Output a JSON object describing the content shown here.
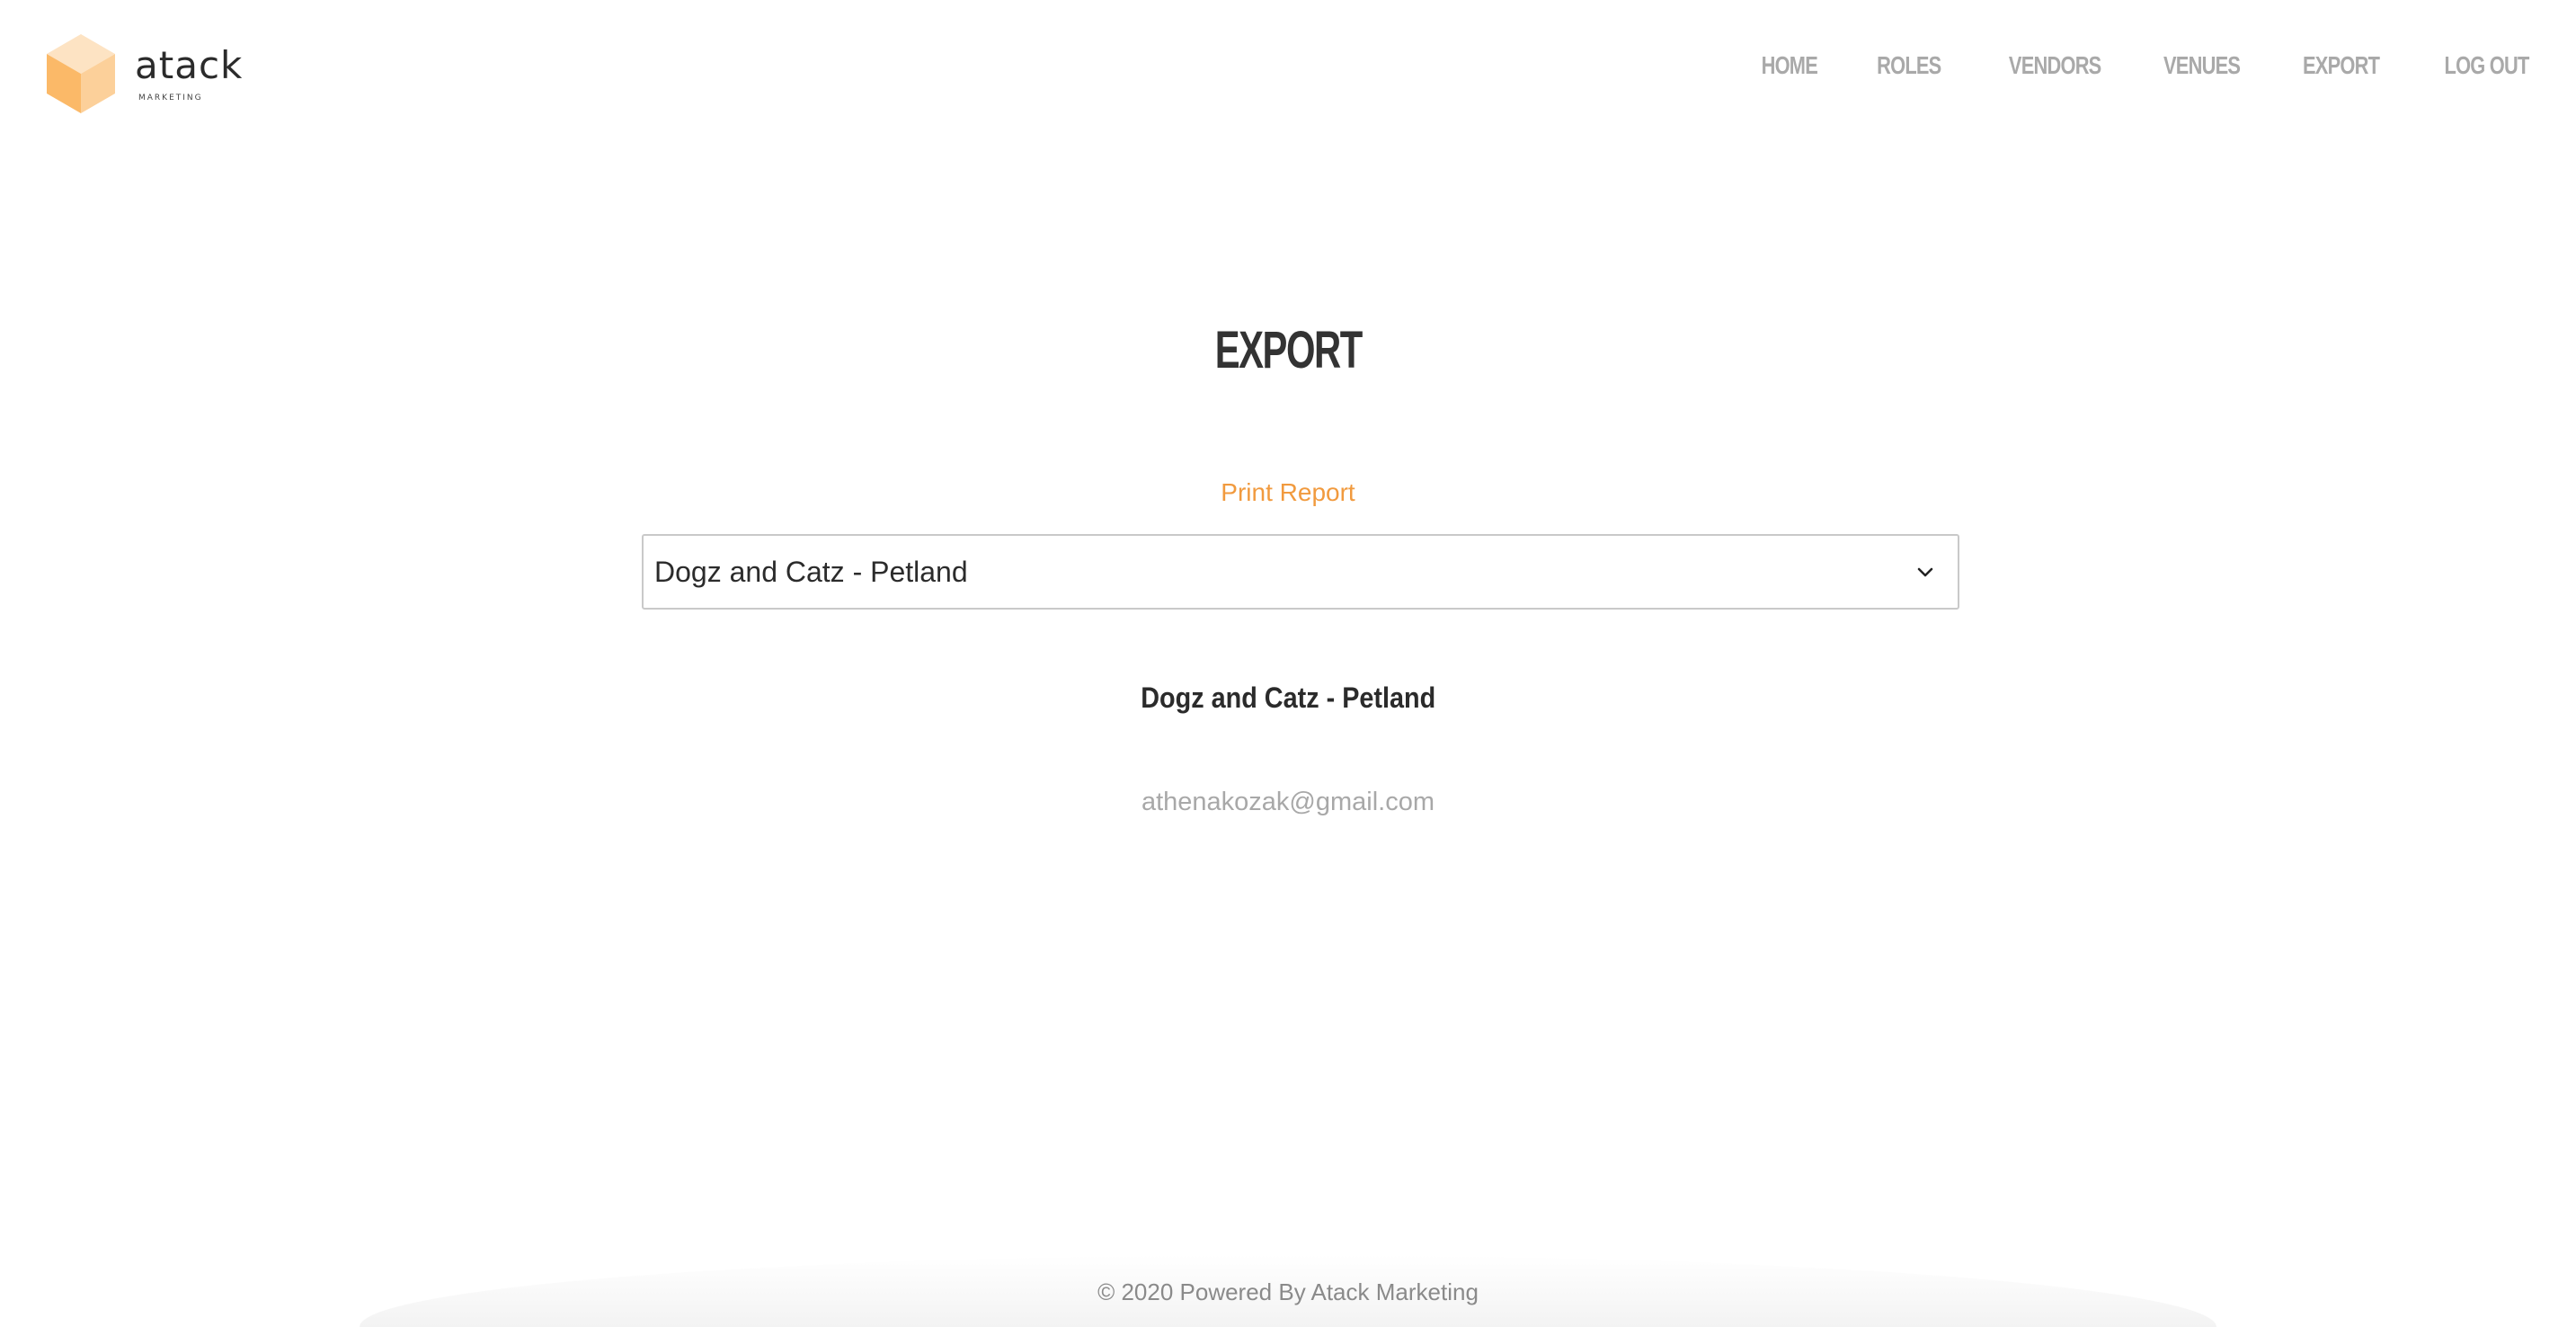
{
  "header": {
    "logo": {
      "wordmark": "atack",
      "subtitle": "MARKETING",
      "cube_colors": {
        "top": "#fde3c3",
        "left": "#fbb968",
        "right": "#fcd09a"
      }
    },
    "nav": [
      {
        "label": "HOME"
      },
      {
        "label": "ROLES"
      },
      {
        "label": "VENDORS"
      },
      {
        "label": "VENUES"
      },
      {
        "label": "EXPORT"
      },
      {
        "label": "LOG OUT"
      }
    ]
  },
  "main": {
    "title": "EXPORT",
    "print_link": "Print Report",
    "select": {
      "value": "Dogz and Catz - Petland"
    },
    "record": {
      "name": "Dogz and Catz - Petland",
      "email": "athenakozak@gmail.com"
    }
  },
  "footer": {
    "text": "© 2020 Powered By Atack Marketing"
  },
  "colors": {
    "accent": "#f19a3e",
    "nav": "#a9a9a9",
    "heading": "#333333",
    "muted": "#a8a8a8"
  }
}
